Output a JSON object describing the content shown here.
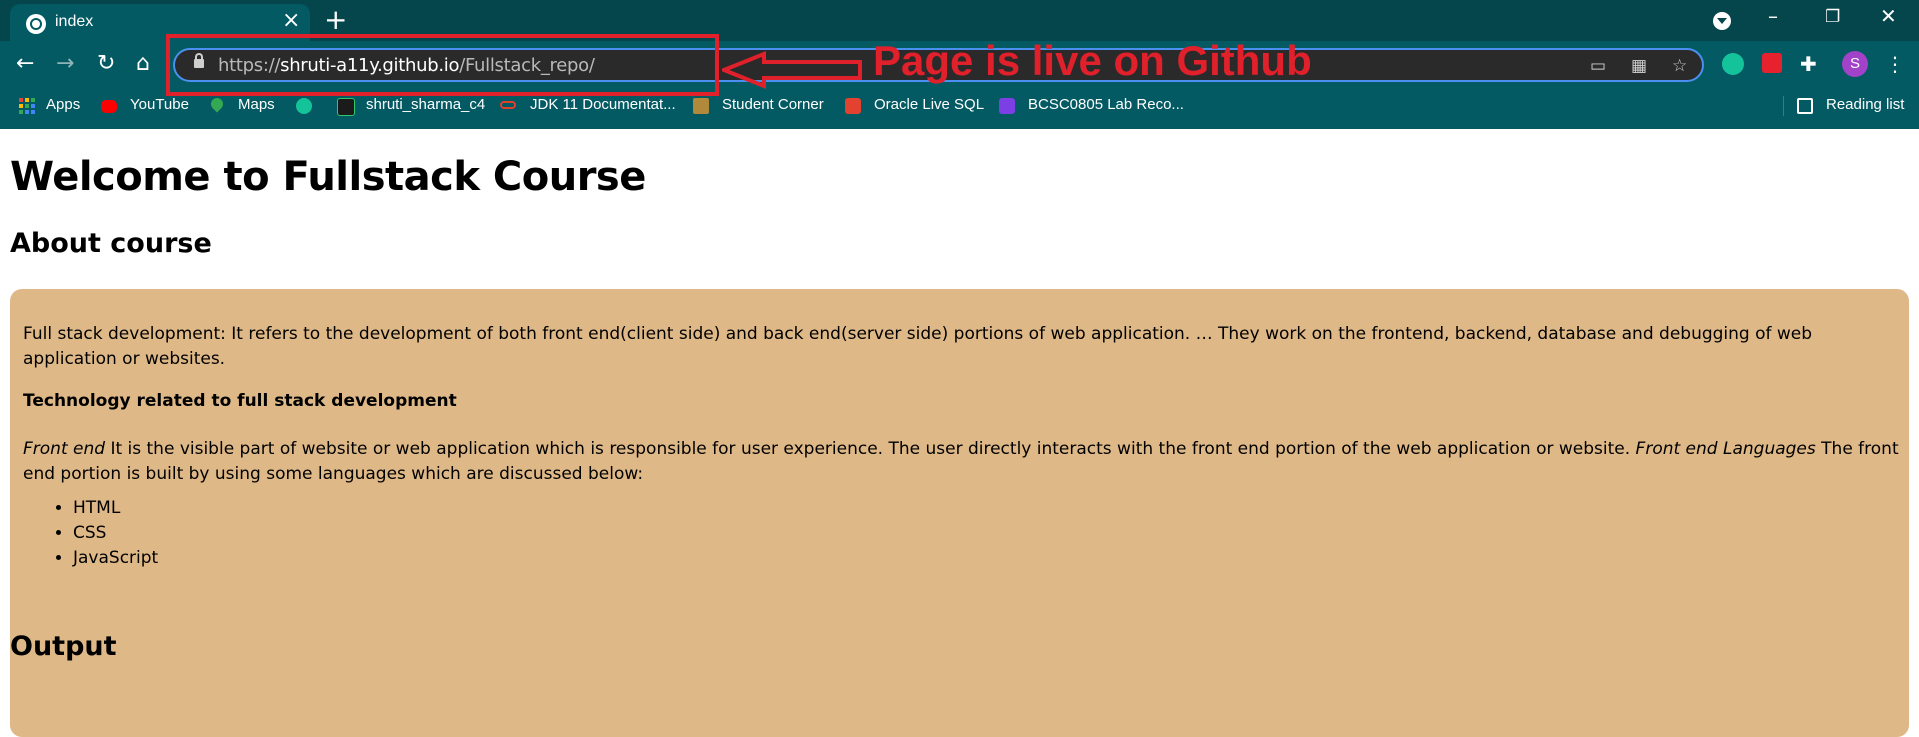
{
  "tab": {
    "title": "index"
  },
  "address_bar": {
    "scheme": "https://",
    "host": "shruti-a11y.github.io",
    "path": "/Fullstack_repo/"
  },
  "bookmarks": [
    {
      "label": "Apps",
      "icon": "apps-grid-icon"
    },
    {
      "label": "YouTube",
      "icon": "youtube-icon"
    },
    {
      "label": "Maps",
      "icon": "maps-icon"
    },
    {
      "label": "",
      "icon": "grammarly-icon"
    },
    {
      "label": "shruti_sharma_c4",
      "icon": "hackerrank-icon"
    },
    {
      "label": "JDK 11 Documentat...",
      "icon": "oracle-icon"
    },
    {
      "label": "Student Corner",
      "icon": "student-corner-icon"
    },
    {
      "label": "Oracle Live SQL",
      "icon": "terminal-icon"
    },
    {
      "label": "BCSC0805 Lab Reco...",
      "icon": "list-icon"
    }
  ],
  "reading_list": "Reading list",
  "profile_initial": "S",
  "annotation": {
    "text": "Page is live on Github",
    "color": "#e0202a"
  },
  "page": {
    "heading": "Welcome to Fullstack Course",
    "about_heading": "About course",
    "intro": "Full stack development: It refers to the development of both front end(client side) and back end(server side) portions of web application. … They work on the frontend, backend, database and debugging of web application or websites.",
    "tech_heading": "Technology related to full stack development",
    "front_end_label": "Front end",
    "front_end_text": " It is the visible part of website or web application which is responsible for user experience. The user directly interacts with the front end portion of the web application or website. ",
    "front_end_languages_label": "Front end Languages",
    "front_end_languages_text": " The front end portion is built by using some languages which are discussed below:",
    "languages": [
      "HTML",
      "CSS",
      "JavaScript"
    ],
    "output_heading": "Output"
  },
  "colors": {
    "chrome": "#035a63",
    "tabstrip": "#05454c",
    "card": "#deb887",
    "omnibox_border": "#4b8ff0"
  }
}
